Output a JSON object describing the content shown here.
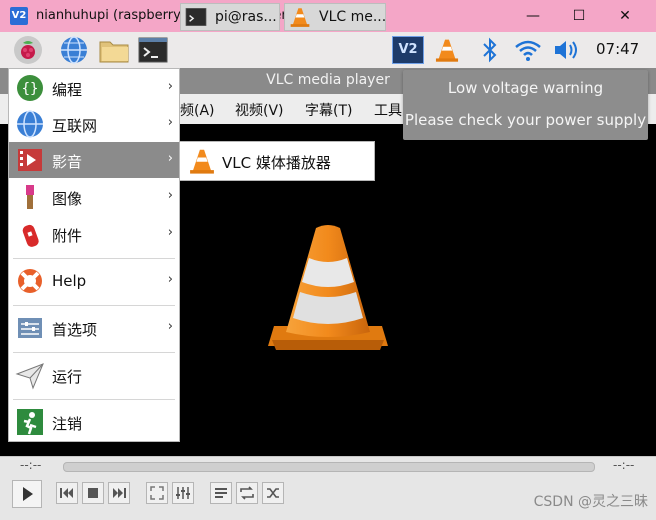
{
  "vnc": {
    "logo": "V2",
    "title": "nianhuhupi (raspberrypi) - VNC Viewer",
    "controls": {
      "minimize": "—",
      "maximize": "☐",
      "close": "✕"
    }
  },
  "panel": {
    "tasks": [
      {
        "label": "pi@ras...",
        "icon": "terminal-icon"
      },
      {
        "label": "VLC me...",
        "icon": "vlc-icon"
      }
    ],
    "tray": {
      "vnc_label": "V2",
      "clock": "07:47"
    }
  },
  "vlc": {
    "title": "VLC media player",
    "menus": [
      {
        "label": "频(A)"
      },
      {
        "label": "视频(V)"
      },
      {
        "label": "字幕(T)"
      },
      {
        "label": "工具"
      }
    ],
    "time_elapsed": "--:--",
    "time_total": "--:--"
  },
  "notification": {
    "title": "Low voltage warning",
    "message": "Please check your power supply"
  },
  "menu": {
    "items": [
      {
        "label": "编程",
        "icon": "programming-icon",
        "submenu": true
      },
      {
        "label": "互联网",
        "icon": "globe-icon",
        "submenu": true
      },
      {
        "label": "影音",
        "icon": "film-icon",
        "submenu": true,
        "active": true
      },
      {
        "label": "图像",
        "icon": "paint-icon",
        "submenu": true
      },
      {
        "label": "附件",
        "icon": "knife-icon",
        "submenu": true
      },
      {
        "label": "Help",
        "icon": "lifebuoy-icon",
        "submenu": true
      },
      {
        "label": "首选项",
        "icon": "settings-icon",
        "submenu": true
      },
      {
        "label": "运行",
        "icon": "paper-plane-icon",
        "submenu": false
      },
      {
        "label": "注销",
        "icon": "exit-icon",
        "submenu": false
      }
    ],
    "arrow": "›",
    "submenu_item": {
      "label": "VLC 媒体播放器",
      "icon": "vlc-icon"
    }
  },
  "watermark": "CSDN @灵之三昧",
  "colors": {
    "vnc_titlebar": "#f4a6c7",
    "menu_highlight": "#8b8b8b",
    "vlc_orange": "#f28a1c",
    "notification": "#8d8d8d"
  }
}
